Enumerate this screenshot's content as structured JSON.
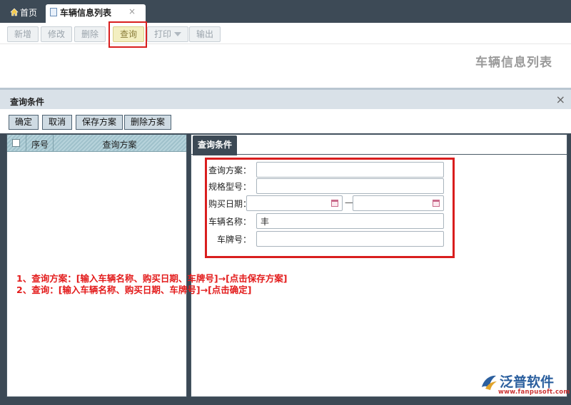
{
  "tabs": {
    "home_label": "首页",
    "active_label": "车辆信息列表",
    "close_glyph": "×"
  },
  "toolbar": {
    "add": "新增",
    "edit": "修改",
    "delete": "删除",
    "query": "查询",
    "print": "打印",
    "export": "输出"
  },
  "page_title": "车辆信息列表",
  "dialog": {
    "title": "查询条件",
    "close_glyph": "×",
    "buttons": {
      "confirm": "确定",
      "cancel": "取消",
      "save_plan": "保存方案",
      "delete_plan": "删除方案"
    },
    "grid": {
      "col_index": "序号",
      "col_plan": "查询方案"
    },
    "form_tab": "查询条件",
    "form": {
      "plan_label": "查询方案：",
      "plan_value": "",
      "spec_label": "规格型号：",
      "spec_value": "",
      "date_label": "购买日期：",
      "date_from": "",
      "date_to": "",
      "date_sep": "—",
      "name_label": "车辆名称：",
      "name_value": "丰",
      "plate_label": "车牌号：",
      "plate_value": ""
    }
  },
  "notes": [
    "1、查询方案：[输入车辆名称、购买日期、车牌号]→[点击保存方案]",
    "2、查询：[输入车辆名称、购买日期、车牌号]→[点击确定]"
  ],
  "brand": {
    "name": "泛普软件",
    "url": "www.fanpusoft.com"
  },
  "colors": {
    "dark_bar": "#3d4a56",
    "highlight_red": "#d91e1e",
    "brand_blue": "#2b5f9e"
  }
}
